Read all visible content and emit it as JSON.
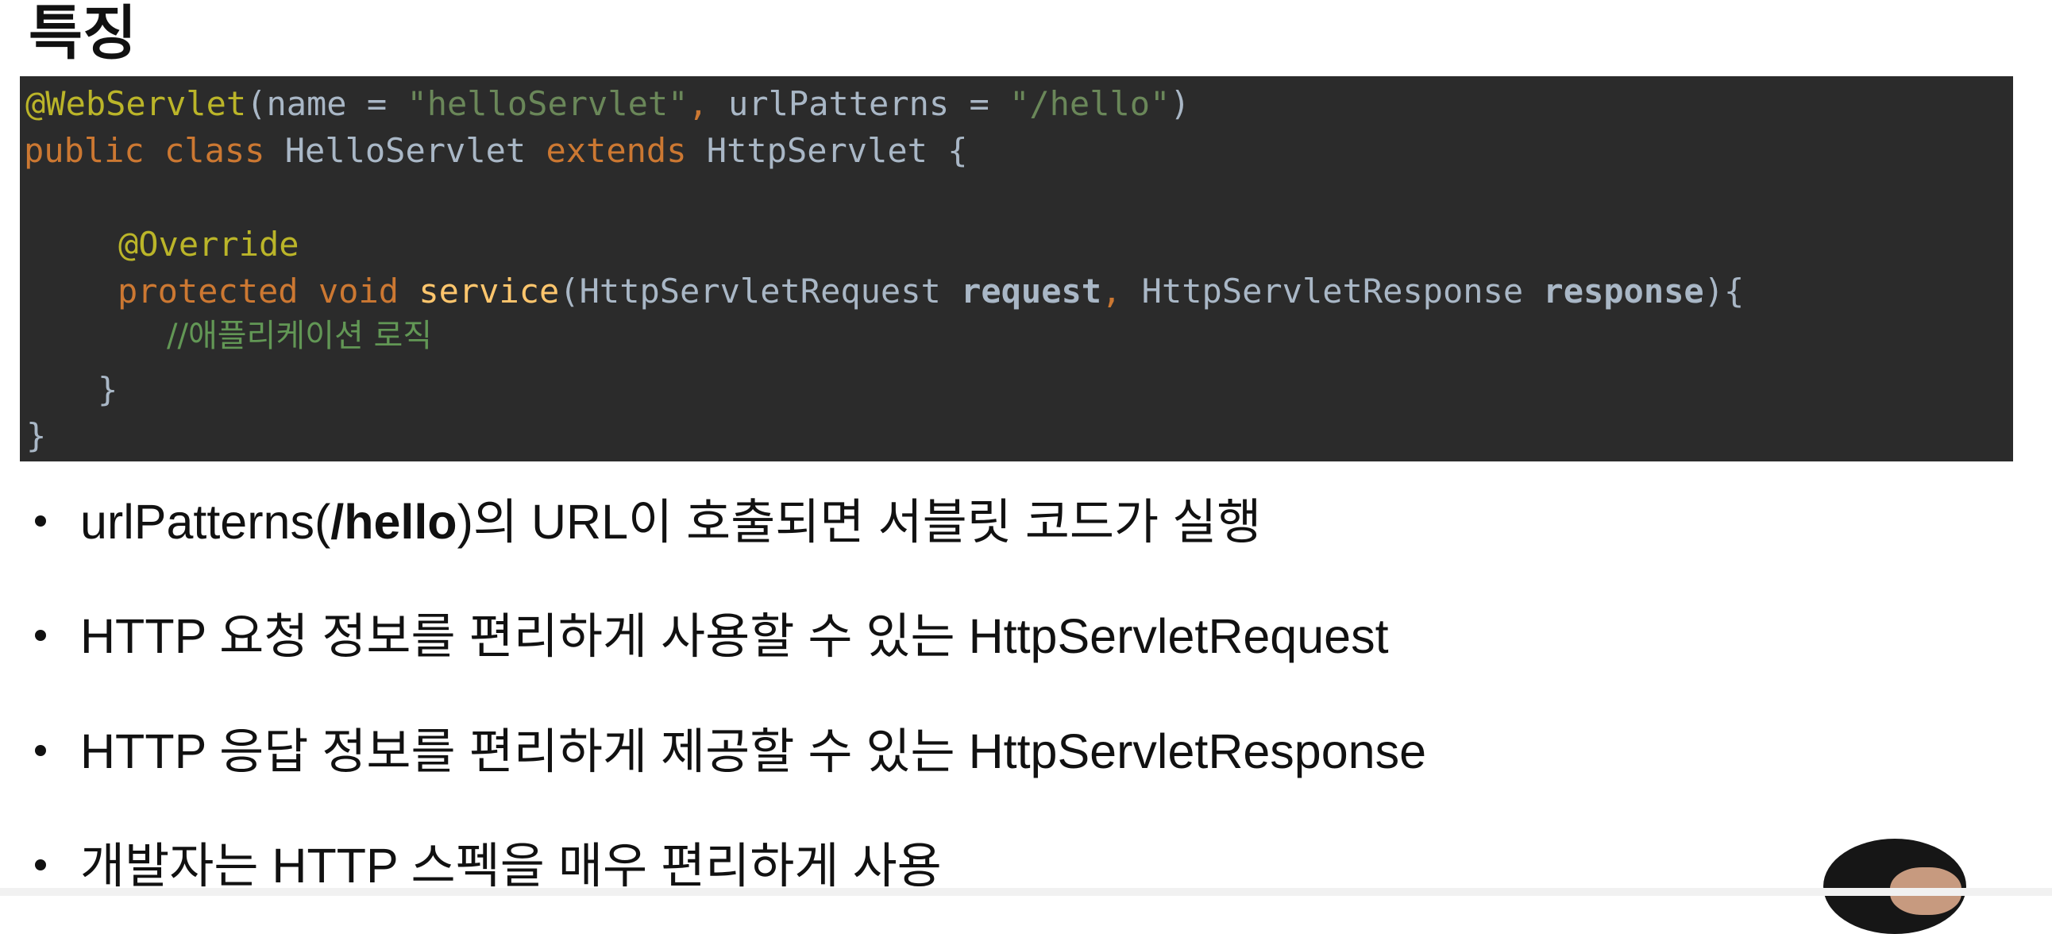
{
  "slide": {
    "title": "특징"
  },
  "code": {
    "line1": {
      "annotation": "@WebServlet",
      "open_paren": "(name = ",
      "name_value": "\"helloServlet\"",
      "comma": ", ",
      "url_key": "urlPatterns = ",
      "url_value": "\"/hello\"",
      "close_paren": ")"
    },
    "line2": {
      "public": "public",
      "class": "class",
      "class_name": "HelloServlet",
      "extends": "extends",
      "parent": "HttpServlet",
      "brace": "{"
    },
    "line3": {
      "annotation": "@Override"
    },
    "line4": {
      "protected": "protected",
      "void": "void",
      "method": "service",
      "open": "(HttpServletRequest ",
      "param1": "request",
      "comma": ", ",
      "type2": "HttpServletResponse ",
      "param2": "response",
      "close": "){"
    },
    "line5": {
      "comment": "//애플리케이션 로직"
    },
    "line6": {
      "brace": "}"
    },
    "line7": {
      "brace": "}"
    }
  },
  "bullets": [
    {
      "before": "urlPatterns(",
      "bold": "/hello",
      "after": ")의 URL이 호출되면 서블릿 코드가 실행"
    },
    {
      "text": "HTTP 요청 정보를 편리하게 사용할 수 있는 HttpServletRequest"
    },
    {
      "text": "HTTP 응답 정보를 편리하게 제공할 수 있는 HttpServletResponse"
    },
    {
      "text": "개발자는 HTTP 스펙을 매우 편리하게 사용"
    }
  ],
  "colors": {
    "code_background": "#2b2b2b",
    "keyword": "#cc7832",
    "annotation": "#bbb529",
    "string": "#6a8759",
    "method": "#ffc66d",
    "default_code": "#a9b7c6",
    "comment": "#629755"
  }
}
